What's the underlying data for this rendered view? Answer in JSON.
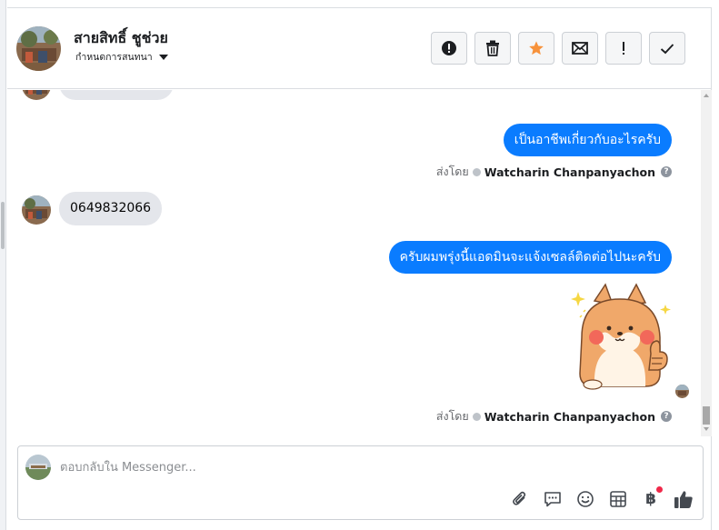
{
  "header": {
    "contact_name": "สายสิทธิ์ ชูช่วย",
    "conversation_label": "กำหนดการสนทนา",
    "actions": [
      {
        "name": "report-button",
        "icon": "alert-circle-icon"
      },
      {
        "name": "delete-button",
        "icon": "trash-icon"
      },
      {
        "name": "star-button",
        "icon": "star-icon",
        "color": "#f7923b"
      },
      {
        "name": "mark-unread-button",
        "icon": "envelope-icon"
      },
      {
        "name": "important-button",
        "icon": "exclamation-icon"
      },
      {
        "name": "mark-done-button",
        "icon": "check-icon"
      }
    ]
  },
  "thread": {
    "messages": [
      {
        "direction": "in",
        "text": ""
      },
      {
        "direction": "out",
        "text": "เป็นอาชีพเกี่ยวกับอะไรครับ"
      },
      {
        "direction": "meta",
        "sent_by_label": "ส่งโดย",
        "sender": "Watcharin Chanpanyachon"
      },
      {
        "direction": "in",
        "text": "0649832066"
      },
      {
        "direction": "out",
        "text": "ครับผมพรุ่งนี้แอดมินจะแจ้งเซลล์ติดต่อไปนะครับ"
      },
      {
        "direction": "out-sticker",
        "sticker": "shiba-thumbs-up-sticker"
      },
      {
        "direction": "meta",
        "sent_by_label": "ส่งโดย",
        "sender": "Watcharin Chanpanyachon"
      }
    ]
  },
  "composer": {
    "placeholder": "ตอบกลับใน Messenger...",
    "tools": [
      "attach-icon",
      "saved-replies-icon",
      "emoji-icon",
      "table-icon",
      "baht-icon",
      "like-icon"
    ],
    "baht_symbol": "฿"
  },
  "colors": {
    "outgoing_bubble": "#0a7cff",
    "incoming_bubble": "#e4e6eb",
    "star": "#f7923b",
    "notify": "#f02849"
  }
}
